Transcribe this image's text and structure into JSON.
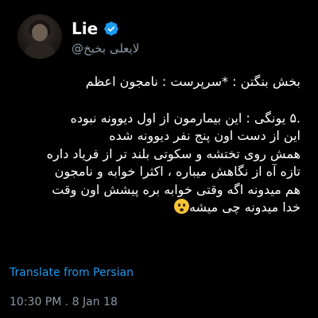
{
  "user": {
    "name": "Lie",
    "handle": "@لایعلی بخبخ"
  },
  "tweet": {
    "line1": "بخش بنگتن : *سرپرست : نامجون اعظم",
    "line2": ".۵ یونگی : این بیمارمون از اول دیوونه نبوده",
    "line3": "این از دست اون پنج نفر دیوونه شده",
    "line4": "همش روی تختشه و سکوتی بلند تر از فریاد داره",
    "line5": "تازه آه از نگاهش میباره ، اکثرا خوابه و نامجون",
    "line6": "هم میدونه اگه وقتی خوابه بره پیشش اون وقت",
    "line7": "خدا میدونه چی میشه"
  },
  "translate_label": "Translate from Persian",
  "timestamp": "10:30 PM . 8 Jan 18",
  "colors": {
    "background": "#000000",
    "link": "#1d9bf0",
    "muted": "#8b98a5",
    "verified": "#1d9bf0"
  },
  "icons": {
    "verified": "verified-badge-icon",
    "emoji": "hushed-face-emoji"
  }
}
